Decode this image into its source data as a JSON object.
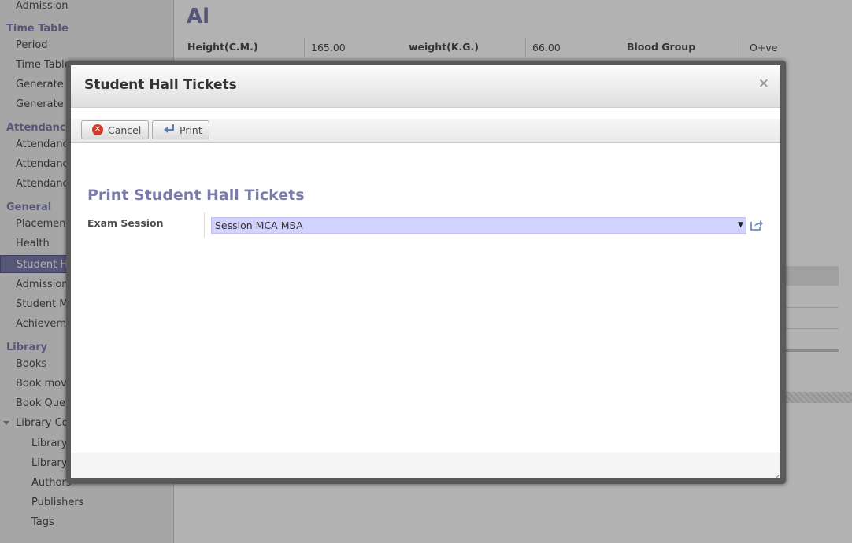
{
  "sidebar": {
    "sections": [
      {
        "label": "Time Table"
      },
      {
        "label": "Attendance"
      },
      {
        "label": "General"
      },
      {
        "label": "Library"
      }
    ],
    "items": [
      {
        "label": "Admission"
      },
      {
        "label": "Period"
      },
      {
        "label": "Time Table"
      },
      {
        "label": "Generate Ti"
      },
      {
        "label": "Generate Ti"
      },
      {
        "label": "Attendance"
      },
      {
        "label": "Attendance"
      },
      {
        "label": "Attendance"
      },
      {
        "label": "Placement C"
      },
      {
        "label": "Health"
      },
      {
        "label": "Student Ha"
      },
      {
        "label": "Admission A"
      },
      {
        "label": "Student Mig"
      },
      {
        "label": "Achievemen"
      },
      {
        "label": "Books"
      },
      {
        "label": "Book mover"
      },
      {
        "label": "Book Queue"
      },
      {
        "label": "Library Conf"
      },
      {
        "label": "Library C"
      },
      {
        "label": "Library C"
      },
      {
        "label": "Authors"
      },
      {
        "label": "Publishers"
      },
      {
        "label": "Tags"
      }
    ],
    "active_item": "Student Ha"
  },
  "background_form": {
    "title": "Al",
    "height_label": "Height(C.M.)",
    "height_value": "165.00",
    "weight_label": "weight(K.G.)",
    "weight_value": "66.00",
    "blood_group_label": "Blood Group",
    "blood_group_value": "O+ve"
  },
  "dialog": {
    "title": "Student Hall Tickets",
    "close_symbol": "×",
    "toolbar": {
      "cancel_label": "Cancel",
      "print_label": "Print"
    },
    "form_title": "Print Student Hall Tickets",
    "fields": {
      "exam_session_label": "Exam Session",
      "exam_session_value": "Session MCA MBA"
    }
  },
  "colors": {
    "accent": "#7c7bad",
    "select_bg": "#d2d2ff",
    "cancel_icon": "#d43a2a"
  }
}
